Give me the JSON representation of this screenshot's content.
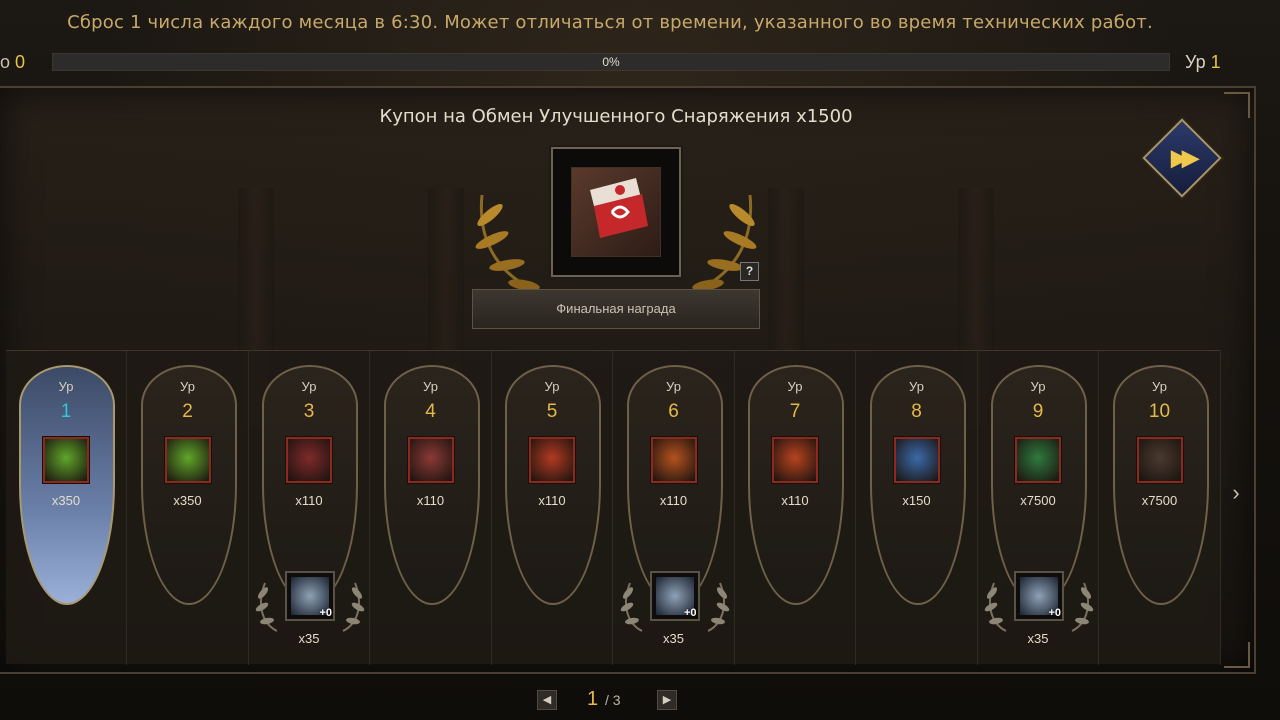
{
  "header": {
    "notice": "Сброс 1 числа каждого месяца в 6:30. Может отличаться от времени, указанного во время технических работ.",
    "xp_prefix": "о",
    "xp_value": "0",
    "progress_fraction": 0,
    "progress_text": "0%",
    "level_label": "Ур",
    "level_value": "1"
  },
  "final_reward": {
    "title": "Купон на Обмен Улучшенного Снаряжения x1500",
    "help": "?",
    "label": "Финальная награда",
    "icon": "exchange-coupon-icon"
  },
  "skip": {
    "icon": "fast-forward-icon",
    "glyph": "▶▶"
  },
  "levels": [
    {
      "label": "Ур",
      "num": "1",
      "qty": "x350",
      "icon": "green-scroll-icon",
      "color": "#5fa62a"
    },
    {
      "label": "Ур",
      "num": "2",
      "qty": "x350",
      "icon": "green-scroll-icon",
      "color": "#5fa62a"
    },
    {
      "label": "Ур",
      "num": "3",
      "qty": "x110",
      "icon": "angel-statue-icon",
      "color": "#7e2a2a",
      "bonus": {
        "qty": "x35",
        "plus": "+0",
        "icon": "jug-icon"
      }
    },
    {
      "label": "Ур",
      "num": "4",
      "qty": "x110",
      "icon": "blade-icon",
      "color": "#8a3a36"
    },
    {
      "label": "Ур",
      "num": "5",
      "qty": "x110",
      "icon": "red-chest-icon",
      "color": "#b23a22"
    },
    {
      "label": "Ур",
      "num": "6",
      "qty": "x110",
      "icon": "gold-chest-icon",
      "color": "#b5521e",
      "bonus": {
        "qty": "x35",
        "plus": "+0",
        "icon": "ring-icon"
      }
    },
    {
      "label": "Ур",
      "num": "7",
      "qty": "x110",
      "icon": "armor-icon",
      "color": "#b8431f"
    },
    {
      "label": "Ур",
      "num": "8",
      "qty": "x150",
      "icon": "blue-scroll-icon",
      "color": "#3b6aa8"
    },
    {
      "label": "Ур",
      "num": "9",
      "qty": "x7500",
      "icon": "green-chest-icon",
      "color": "#2f7a3e",
      "bonus": {
        "qty": "x35",
        "plus": "+0",
        "icon": "flower-bracelet-icon"
      }
    },
    {
      "label": "Ур",
      "num": "10",
      "qty": "x7500",
      "icon": "coin-pouch-icon",
      "color": "#4a3a30"
    }
  ],
  "next": {
    "glyph": "›"
  },
  "pager": {
    "current": "1",
    "total": "3",
    "separator": "/",
    "prev": "◀",
    "next": "▶"
  }
}
